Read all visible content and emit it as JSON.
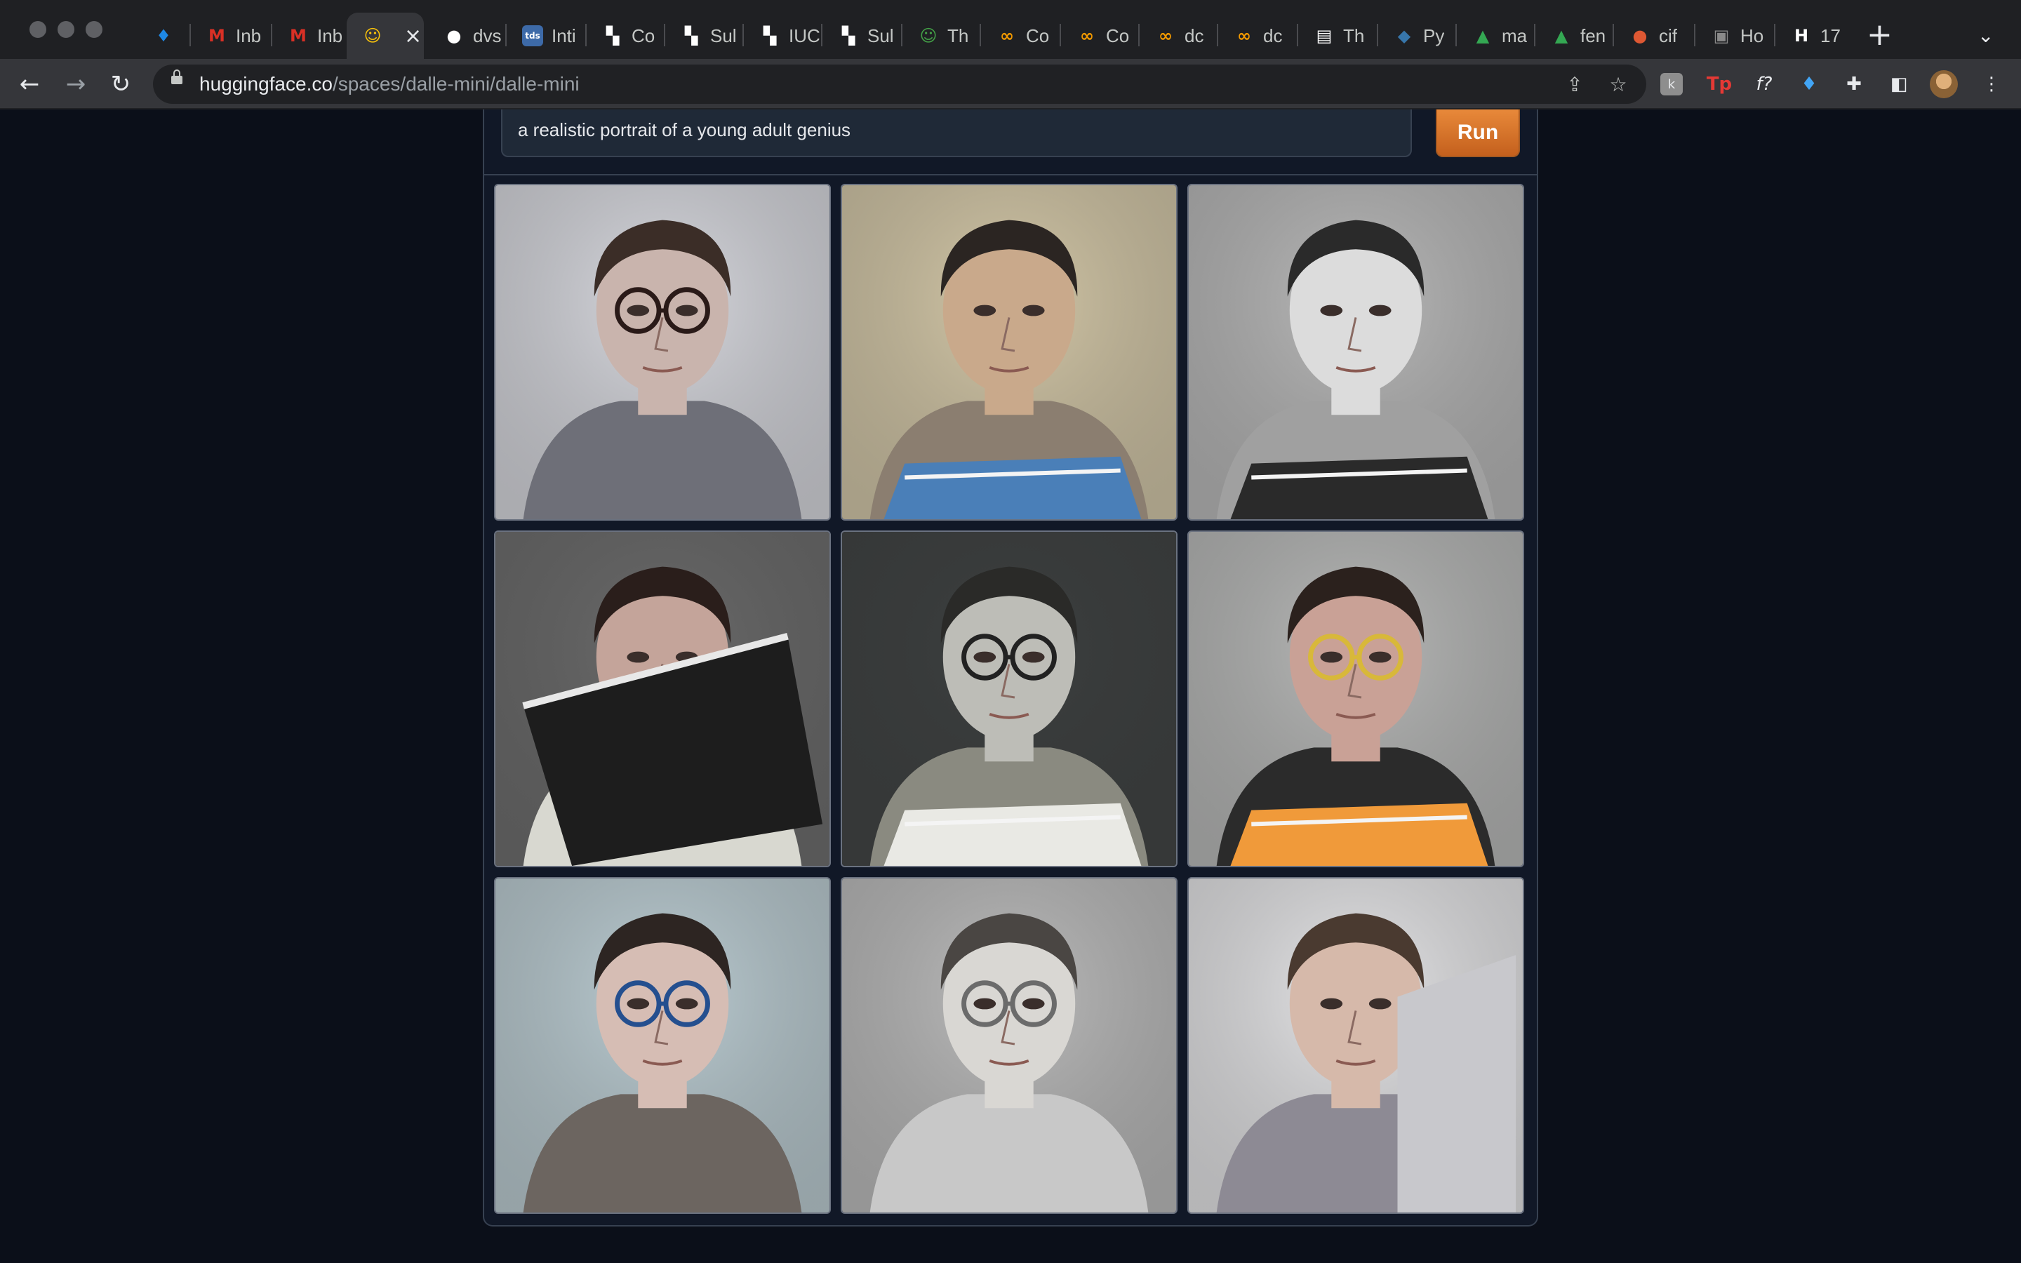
{
  "browser": {
    "tabs": [
      {
        "label": "",
        "favicon": "diamond-icon",
        "color": "#1e88e5",
        "glyph": "♦"
      },
      {
        "label": "Inb",
        "favicon": "gmail-icon",
        "color": "#d93025",
        "glyph": "M"
      },
      {
        "label": "Inb",
        "favicon": "gmail-icon",
        "color": "#d93025",
        "glyph": "M"
      },
      {
        "label": "",
        "favicon": "huggingface-icon",
        "color": "#f9c20a",
        "glyph": "☺",
        "active": true
      },
      {
        "label": "dvs",
        "favicon": "github-icon",
        "color": "#ffffff",
        "glyph": "●"
      },
      {
        "label": "Inti",
        "favicon": "tds-icon",
        "color": "#3d6aa8",
        "glyph": "tds"
      },
      {
        "label": "Co",
        "favicon": "qr-icon",
        "color": "#ffffff",
        "glyph": "▚"
      },
      {
        "label": "Sul",
        "favicon": "qr-icon",
        "color": "#ffffff",
        "glyph": "▚"
      },
      {
        "label": "IUC",
        "favicon": "qr-icon",
        "color": "#ffffff",
        "glyph": "▚"
      },
      {
        "label": "Sul",
        "favicon": "qr-icon",
        "color": "#ffffff",
        "glyph": "▚"
      },
      {
        "label": "Th",
        "favicon": "smiley-icon",
        "color": "#43a047",
        "glyph": "☺"
      },
      {
        "label": "Co",
        "favicon": "infinity-icon",
        "color": "#f29900",
        "glyph": "∞"
      },
      {
        "label": "Co",
        "favicon": "infinity-icon",
        "color": "#f29900",
        "glyph": "∞"
      },
      {
        "label": "dc",
        "favicon": "infinity-icon",
        "color": "#f29900",
        "glyph": "∞"
      },
      {
        "label": "dc",
        "favicon": "infinity-icon",
        "color": "#f29900",
        "glyph": "∞"
      },
      {
        "label": "Th",
        "favicon": "newspaper-icon",
        "color": "#ffffff",
        "glyph": "▤"
      },
      {
        "label": "Py",
        "favicon": "python-icon",
        "color": "#3776ab",
        "glyph": "◆"
      },
      {
        "label": "ma",
        "favicon": "drive-icon",
        "color": "#34a853",
        "glyph": "▲"
      },
      {
        "label": "fen",
        "favicon": "drive-icon",
        "color": "#34a853",
        "glyph": "▲"
      },
      {
        "label": "cif",
        "favicon": "duckduckgo-icon",
        "color": "#de5833",
        "glyph": "●"
      },
      {
        "label": "Ho",
        "favicon": "photo-icon",
        "color": "#8a8a8a",
        "glyph": "▣"
      },
      {
        "label": "17",
        "favicon": "hp-icon",
        "color": "#ffffff",
        "glyph": "H"
      }
    ],
    "url_host": "huggingface.co",
    "url_path": "/spaces/dalle-mini/dalle-mini"
  },
  "app": {
    "prompt_value": "a realistic portrait of a young adult genius",
    "run_label": "Run",
    "accent": "#d97a2c",
    "images": [
      {
        "name": "portrait-1",
        "bg": "#d8d9df",
        "hair": "#3b2d27",
        "skin": "#c9b4ad",
        "shirt": "#6e6f78",
        "glasses": true,
        "glasses_color": "#2a1a18",
        "prop": "none",
        "prop_color": "#ffffff"
      },
      {
        "name": "portrait-2",
        "bg": "#d4c8a8",
        "hair": "#2b2522",
        "skin": "#c9a98b",
        "shirt": "#8b7e70",
        "glasses": false,
        "glasses_color": "#000000",
        "prop": "book",
        "prop_color": "#4a7fb8"
      },
      {
        "name": "portrait-3",
        "bg": "#b9b9b9",
        "hair": "#2a2a2a",
        "skin": "#dcdcdc",
        "shirt": "#a0a0a0",
        "glasses": false,
        "glasses_color": "#000000",
        "prop": "book",
        "prop_color": "#2a2a2a"
      },
      {
        "name": "portrait-4",
        "bg": "#6a6a6a",
        "hair": "#2a1e1b",
        "skin": "#c4a49a",
        "shirt": "#d8d8d0",
        "glasses": false,
        "glasses_color": "#000000",
        "prop": "folder",
        "prop_color": "#1d1d1d"
      },
      {
        "name": "portrait-5",
        "bg": "#3c3f3f",
        "hair": "#2a2a28",
        "skin": "#bdbdb7",
        "shirt": "#8a8a80",
        "glasses": true,
        "glasses_color": "#222222",
        "prop": "book",
        "prop_color": "#e9e9e4"
      },
      {
        "name": "portrait-6",
        "bg": "#b8b9b8",
        "hair": "#2b211d",
        "skin": "#c9a196",
        "shirt": "#2b2b2b",
        "glasses": true,
        "glasses_color": "#d8b83a",
        "prop": "book",
        "prop_color": "#f09a3a"
      },
      {
        "name": "portrait-7",
        "bg": "#bccdd3",
        "hair": "#2d2522",
        "skin": "#d6bdb4",
        "shirt": "#6c6560",
        "glasses": true,
        "glasses_color": "#244f8f",
        "prop": "none",
        "prop_color": "#ffffff"
      },
      {
        "name": "portrait-8",
        "bg": "#bcbcbc",
        "hair": "#4a4643",
        "skin": "#d9d7d3",
        "shirt": "#c8c8c8",
        "glasses": true,
        "glasses_color": "#6b6b6b",
        "prop": "none",
        "prop_color": "#ffffff"
      },
      {
        "name": "portrait-9",
        "bg": "#e6e6e8",
        "hair": "#4a3a30",
        "skin": "#d6b9aa",
        "shirt": "#8d8a94",
        "glasses": false,
        "glasses_color": "#000000",
        "prop": "laptop",
        "prop_color": "#c8c8cc"
      }
    ]
  }
}
